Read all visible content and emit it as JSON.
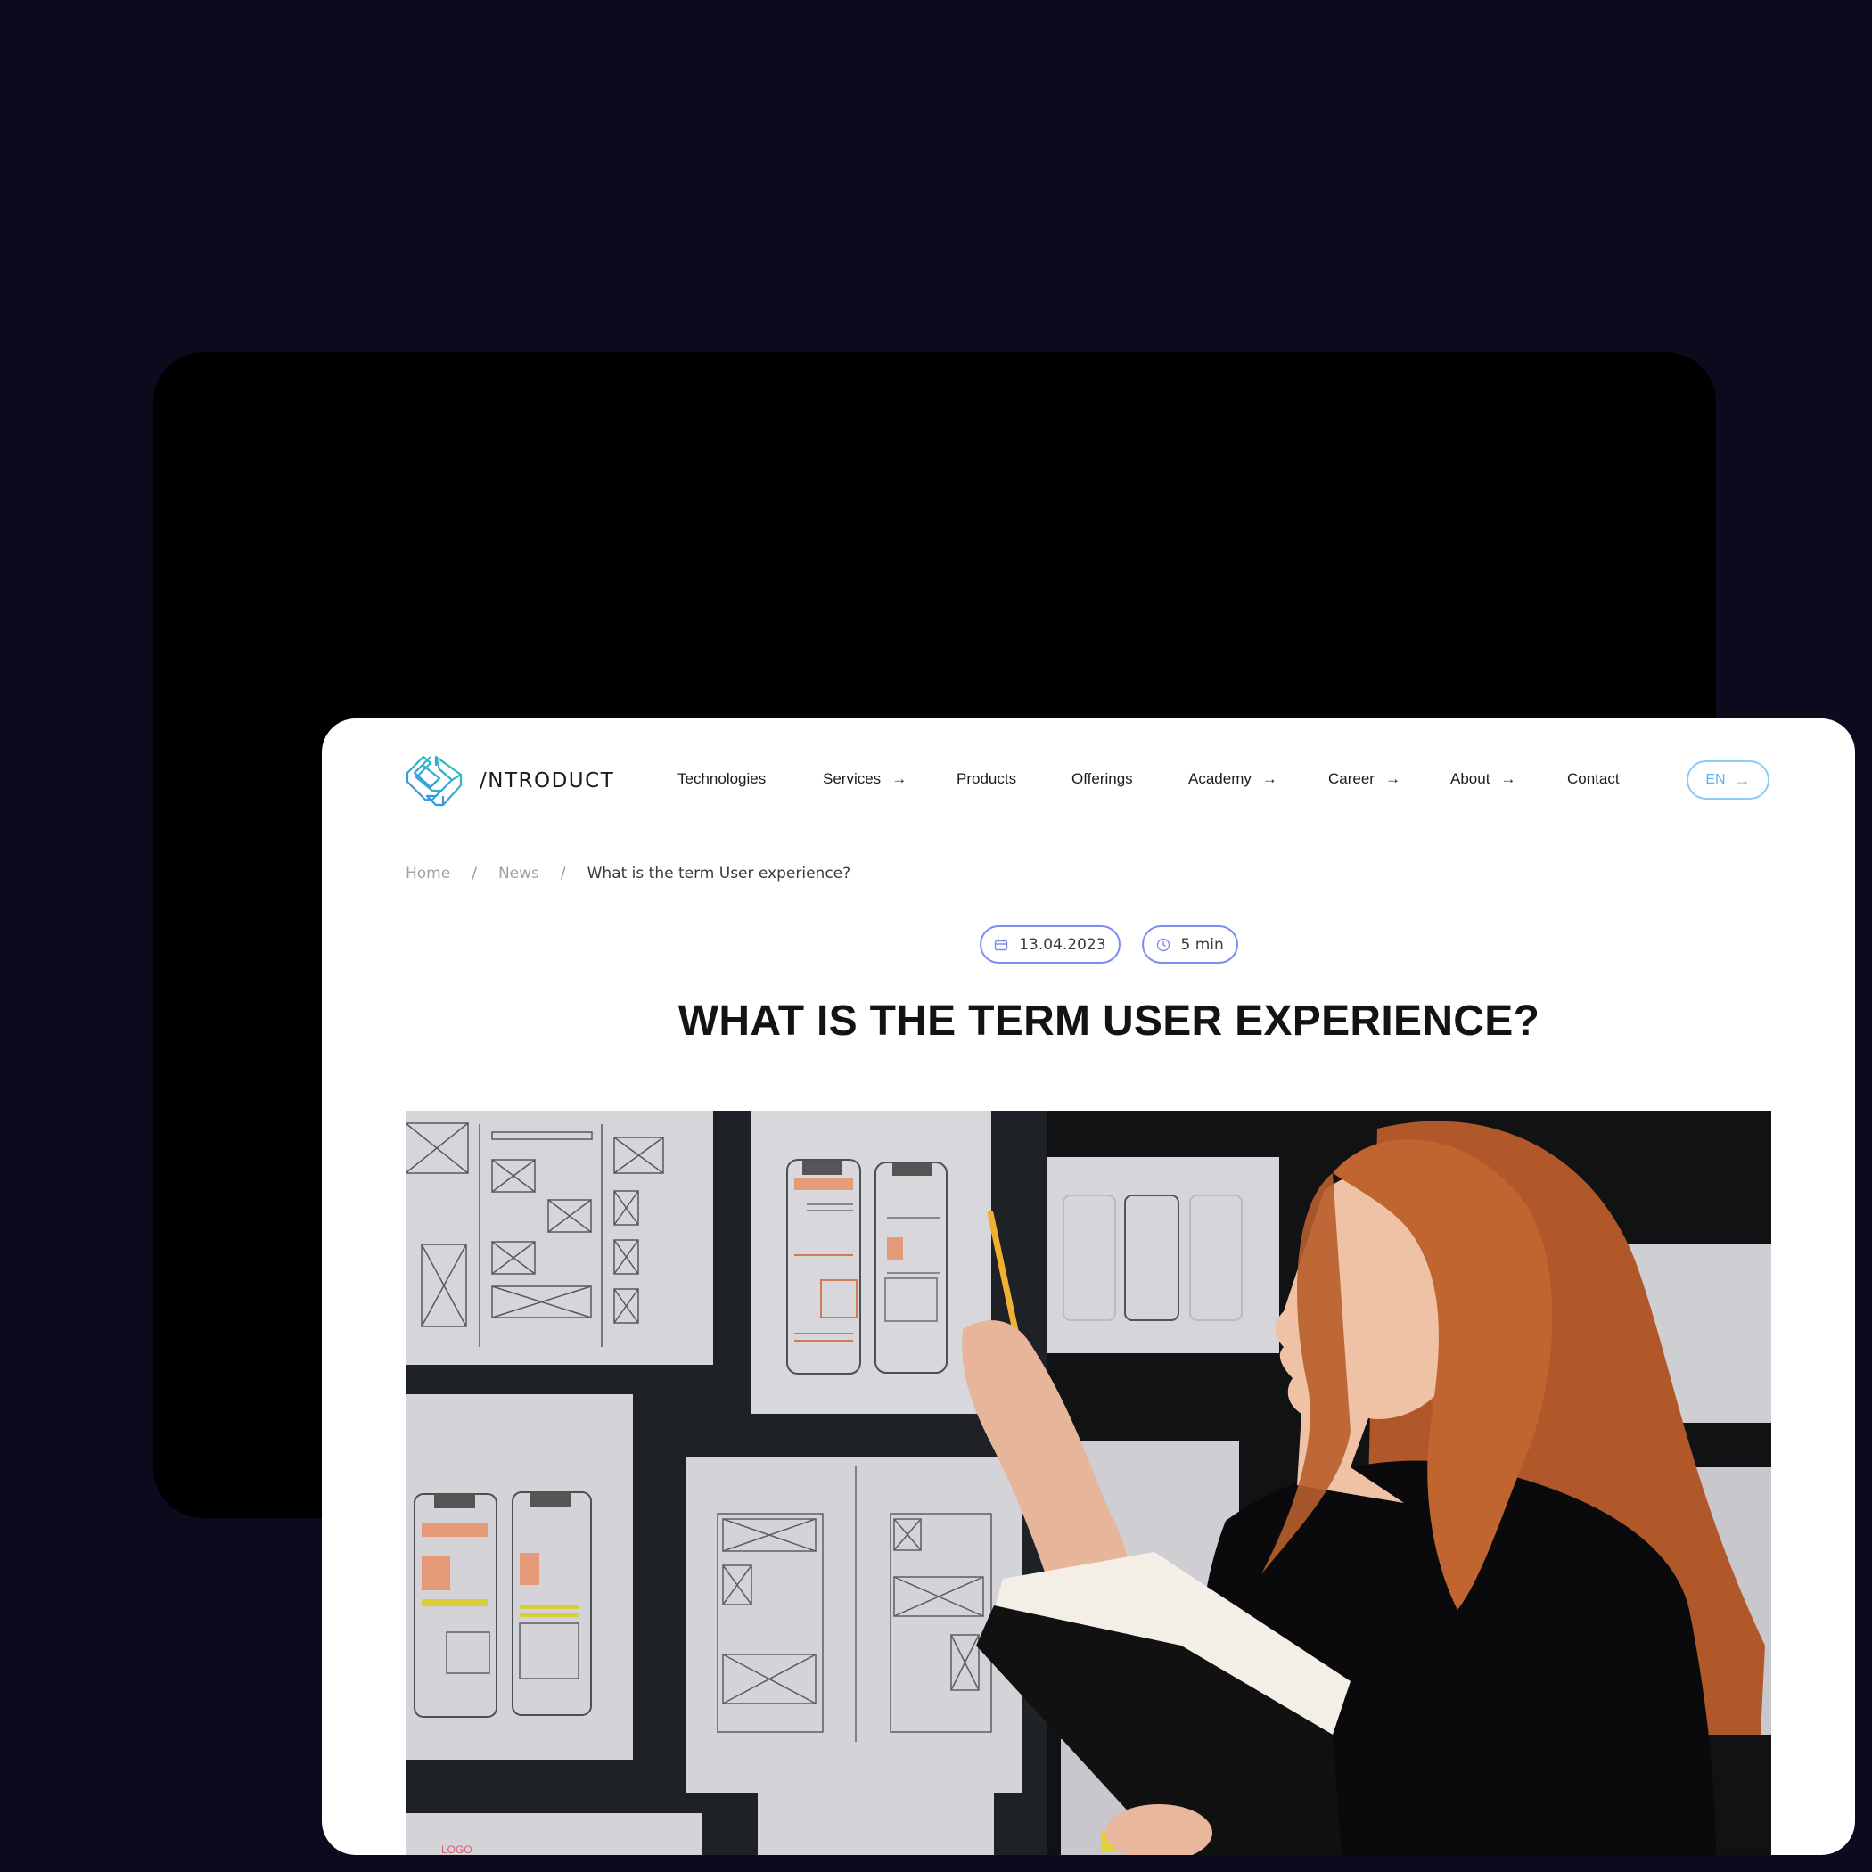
{
  "brand": {
    "name": "/NTRODUCT",
    "logo_icon": "hexagon-loop-logo-icon",
    "gradient_colors": [
      "#2fc4b2",
      "#3a8ef0"
    ]
  },
  "nav": {
    "items": [
      {
        "label": "Technologies",
        "has_arrow": false
      },
      {
        "label": "Services",
        "has_arrow": true
      },
      {
        "label": "Products",
        "has_arrow": false
      },
      {
        "label": "Offerings",
        "has_arrow": false
      },
      {
        "label": "Academy",
        "has_arrow": true
      },
      {
        "label": "Career",
        "has_arrow": true
      },
      {
        "label": "About",
        "has_arrow": true
      },
      {
        "label": "Contact",
        "has_arrow": false
      }
    ],
    "arrow_glyph": "→",
    "language_button": {
      "label": "EN",
      "icon": "arrow-right-icon",
      "color": "#5ab4f2"
    }
  },
  "breadcrumb": {
    "items": [
      "Home",
      "News"
    ],
    "separator": "/",
    "current": "What is the term User experience?"
  },
  "article": {
    "date": "13.04.2023",
    "date_icon": "calendar-icon",
    "read_time": "5 min",
    "read_time_icon": "clock-icon",
    "pill_border_color": "#7c8cf0",
    "title": "WHAT IS THE TERM USER EXPERIENCE?",
    "hero_image": {
      "description": "Red-haired woman in black sweater holding an open notebook and pointing a pencil at paper UX wireframe sketches pinned on a dark wall",
      "sketch_labels": [
        "LOGO"
      ]
    }
  },
  "colors": {
    "page_background": "#0c0a1d",
    "device_frame": "#000000",
    "text_primary": "#131316",
    "text_muted": "#a0a0a6"
  }
}
